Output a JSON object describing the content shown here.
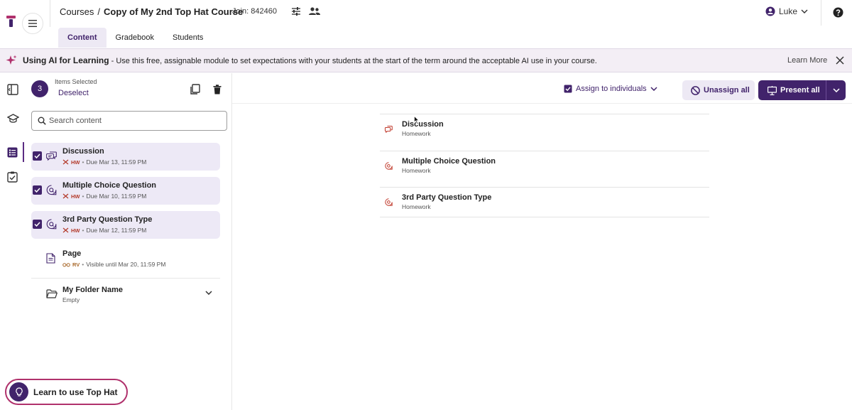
{
  "header": {
    "breadcrumb_root": "Courses",
    "breadcrumb_sep": "/",
    "course_title": "Copy of My 2nd Top Hat Course",
    "join_code": "Join: 842460",
    "user_name": "Luke"
  },
  "tabs": [
    {
      "label": "Content",
      "active": true
    },
    {
      "label": "Gradebook",
      "active": false
    },
    {
      "label": "Students",
      "active": false
    }
  ],
  "banner": {
    "title": "Using AI for Learning",
    "text": " - Use this free, assignable module to set expectations with your students at the start of the term around the acceptable AI use in your course.",
    "learn_more": "Learn More"
  },
  "selection": {
    "count": "3",
    "label": "Items Selected",
    "deselect": "Deselect"
  },
  "search": {
    "placeholder": "Search content"
  },
  "items": [
    {
      "title": "Discussion",
      "tag": "HW",
      "meta": "Due Mar 13, 11:59 PM",
      "selected": true,
      "icon": "discussion-icon"
    },
    {
      "title": "Multiple Choice Question",
      "tag": "HW",
      "meta": "Due Mar 10, 11:59 PM",
      "selected": true,
      "icon": "question-icon"
    },
    {
      "title": "3rd Party Question Type",
      "tag": "HW",
      "meta": "Due Mar 12, 11:59 PM",
      "selected": true,
      "icon": "question-icon"
    },
    {
      "title": "Page",
      "tag": "RV",
      "meta": "Visible until Mar 20, 11:59 PM",
      "selected": false,
      "icon": "page-icon"
    }
  ],
  "folder": {
    "title": "My Folder Name",
    "sub": "Empty"
  },
  "toolbar": {
    "assign": "Assign to individuals",
    "unassign": "Unassign all",
    "present": "Present all"
  },
  "preview": [
    {
      "title": "Discussion",
      "sub": "Homework"
    },
    {
      "title": "Multiple Choice Question",
      "sub": "Homework"
    },
    {
      "title": "3rd Party Question Type",
      "sub": "Homework"
    }
  ],
  "learn_pill": {
    "label": "Learn to use Top Hat"
  },
  "colors": {
    "primary": "#41236b",
    "banner_bg": "#f3eef5",
    "selected_bg": "#ede9f6",
    "hw_tag": "#b33a2a",
    "pill_border": "#b0316c"
  }
}
